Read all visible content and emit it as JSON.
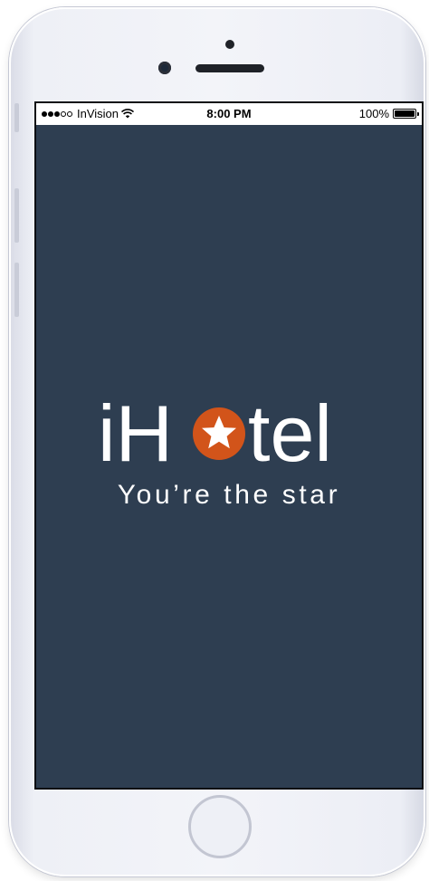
{
  "status_bar": {
    "signal_strength": "3 of 5",
    "carrier": "InVision",
    "wifi_icon": "wifi-icon",
    "time": "8:00 PM",
    "battery_percent": "100%",
    "battery_level": 1.0
  },
  "splash": {
    "logo_prefix": "iH",
    "logo_suffix": "tel",
    "logo_icon": "star-icon",
    "tagline": "You’re the star"
  },
  "colors": {
    "screen_background": "#2e3e51",
    "logo_text": "#ffffff",
    "star_circle": "#d2541a",
    "star": "#ffffff"
  }
}
